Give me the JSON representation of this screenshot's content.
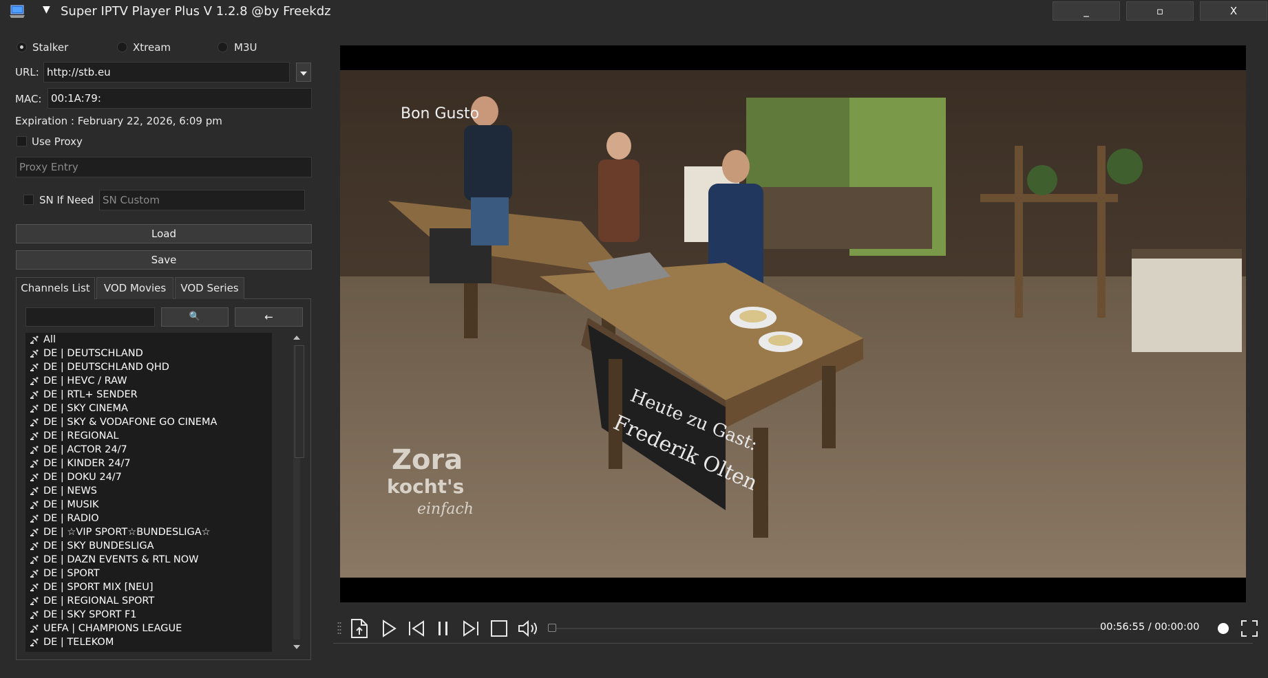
{
  "window": {
    "title": "Super IPTV Player Plus V 1.2.8 @by Freekdz",
    "minimize_label": "_",
    "maximize_label": "▫",
    "close_label": "X",
    "menu_arrow": "▼"
  },
  "source_modes": {
    "options": [
      "Stalker",
      "Xtream",
      "M3U"
    ],
    "selected": "Stalker"
  },
  "connection": {
    "url_label": "URL:",
    "url_value": "http://stb.eu",
    "mac_label": "MAC:",
    "mac_value": "00:1A:79:",
    "expiration": "Expiration : February 22, 2026, 6:09 pm"
  },
  "proxy": {
    "use_proxy_label": "Use Proxy",
    "use_proxy_checked": false,
    "proxy_placeholder": "Proxy Entry"
  },
  "sn": {
    "sn_label": "SN If Need",
    "sn_checked": false,
    "sn_placeholder": "SN Custom"
  },
  "actions": {
    "load_label": "Load",
    "save_label": "Save"
  },
  "tabs": [
    {
      "label": "Channels List",
      "active": true
    },
    {
      "label": "VOD Movies",
      "active": false
    },
    {
      "label": "VOD Series",
      "active": false
    }
  ],
  "channel_search": {
    "value": "",
    "search_icon": "🔍",
    "back_icon": "←"
  },
  "channels": [
    "All",
    "DE | DEUTSCHLAND",
    "DE | DEUTSCHLAND QHD",
    "DE | HEVC / RAW",
    "DE | RTL+ SENDER",
    "DE | SKY CINEMA",
    "DE | SKY & VODAFONE GO CINEMA",
    "DE | REGIONAL",
    "DE | ACTOR 24/7",
    "DE | KINDER 24/7",
    "DE | DOKU 24/7",
    "DE | NEWS",
    "DE | MUSIK",
    "DE | RADIO",
    "DE | ☆VIP SPORT☆BUNDESLIGA☆",
    "DE | SKY BUNDESLIGA",
    "DE | DAZN EVENTS & RTL NOW",
    "DE | SPORT",
    "DE | SPORT MIX [NEU]",
    "DE | REGIONAL SPORT",
    "DE | SKY SPORT F1",
    "UEFA | CHAMPIONS LEAGUE",
    "DE | TELEKOM"
  ],
  "video": {
    "overlay_top": "Bon Gusto",
    "overlay_show_line1": "Zora",
    "overlay_show_line2": "kocht's",
    "overlay_show_line3": "einfach",
    "chalkboard_line1": "Heute zu Gast:",
    "chalkboard_line2": "Frederik Olten"
  },
  "player": {
    "time": "00:56:55 / 00:00:00",
    "seek_fraction": 0.0,
    "icons": [
      "drag-handle-icon",
      "open-file-icon",
      "play-icon",
      "skip-back-icon",
      "pause-icon",
      "skip-forward-icon",
      "stop-icon",
      "volume-icon",
      "volume-dot-icon",
      "fullscreen-icon"
    ]
  },
  "colors": {
    "background": "#2b2b2b",
    "list_background": "#1c1c1c",
    "field_background": "#1e1e1e",
    "button_background": "#3a3a3a"
  }
}
